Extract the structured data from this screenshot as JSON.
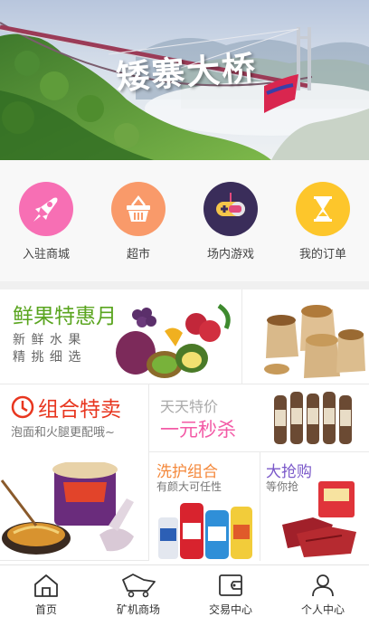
{
  "banner": {
    "title": "矮寨大桥"
  },
  "quick_nav": [
    {
      "label": "入驻商城",
      "icon": "rocket-icon",
      "color": "#f76fb4"
    },
    {
      "label": "超市",
      "icon": "basket-icon",
      "color": "#f99a6a"
    },
    {
      "label": "场内游戏",
      "icon": "gamepad-icon",
      "color": "#3a2d5a"
    },
    {
      "label": "我的订单",
      "icon": "hourglass-icon",
      "color": "#fdc62b"
    }
  ],
  "promos": {
    "fruit": {
      "title": "鲜果特惠月",
      "line1": "新 鲜 水 果",
      "line2": "精 挑 细 选"
    },
    "combo": {
      "title": "组合特卖",
      "subtitle": "泡面和火腿更配哦~"
    },
    "flash": {
      "title": "天天特价",
      "subtitle": "一元秒杀"
    },
    "care": {
      "title": "洗护组合",
      "subtitle": "有颜大可任性"
    },
    "grab": {
      "title": "大抢购",
      "subtitle": "等你抢"
    }
  },
  "tabbar": [
    {
      "label": "首页",
      "icon": "home-icon"
    },
    {
      "label": "矿机商场",
      "icon": "mining-cart-icon"
    },
    {
      "label": "交易中心",
      "icon": "wallet-icon"
    },
    {
      "label": "个人中心",
      "icon": "user-icon"
    }
  ],
  "colors": {
    "fruit_title": "#5aa51f",
    "combo_title": "#e8361f",
    "flash_title": "#aaaaaa",
    "flash_subtitle": "#f35aa6",
    "care_title": "#f4883b",
    "grab_title": "#7a58c9"
  }
}
